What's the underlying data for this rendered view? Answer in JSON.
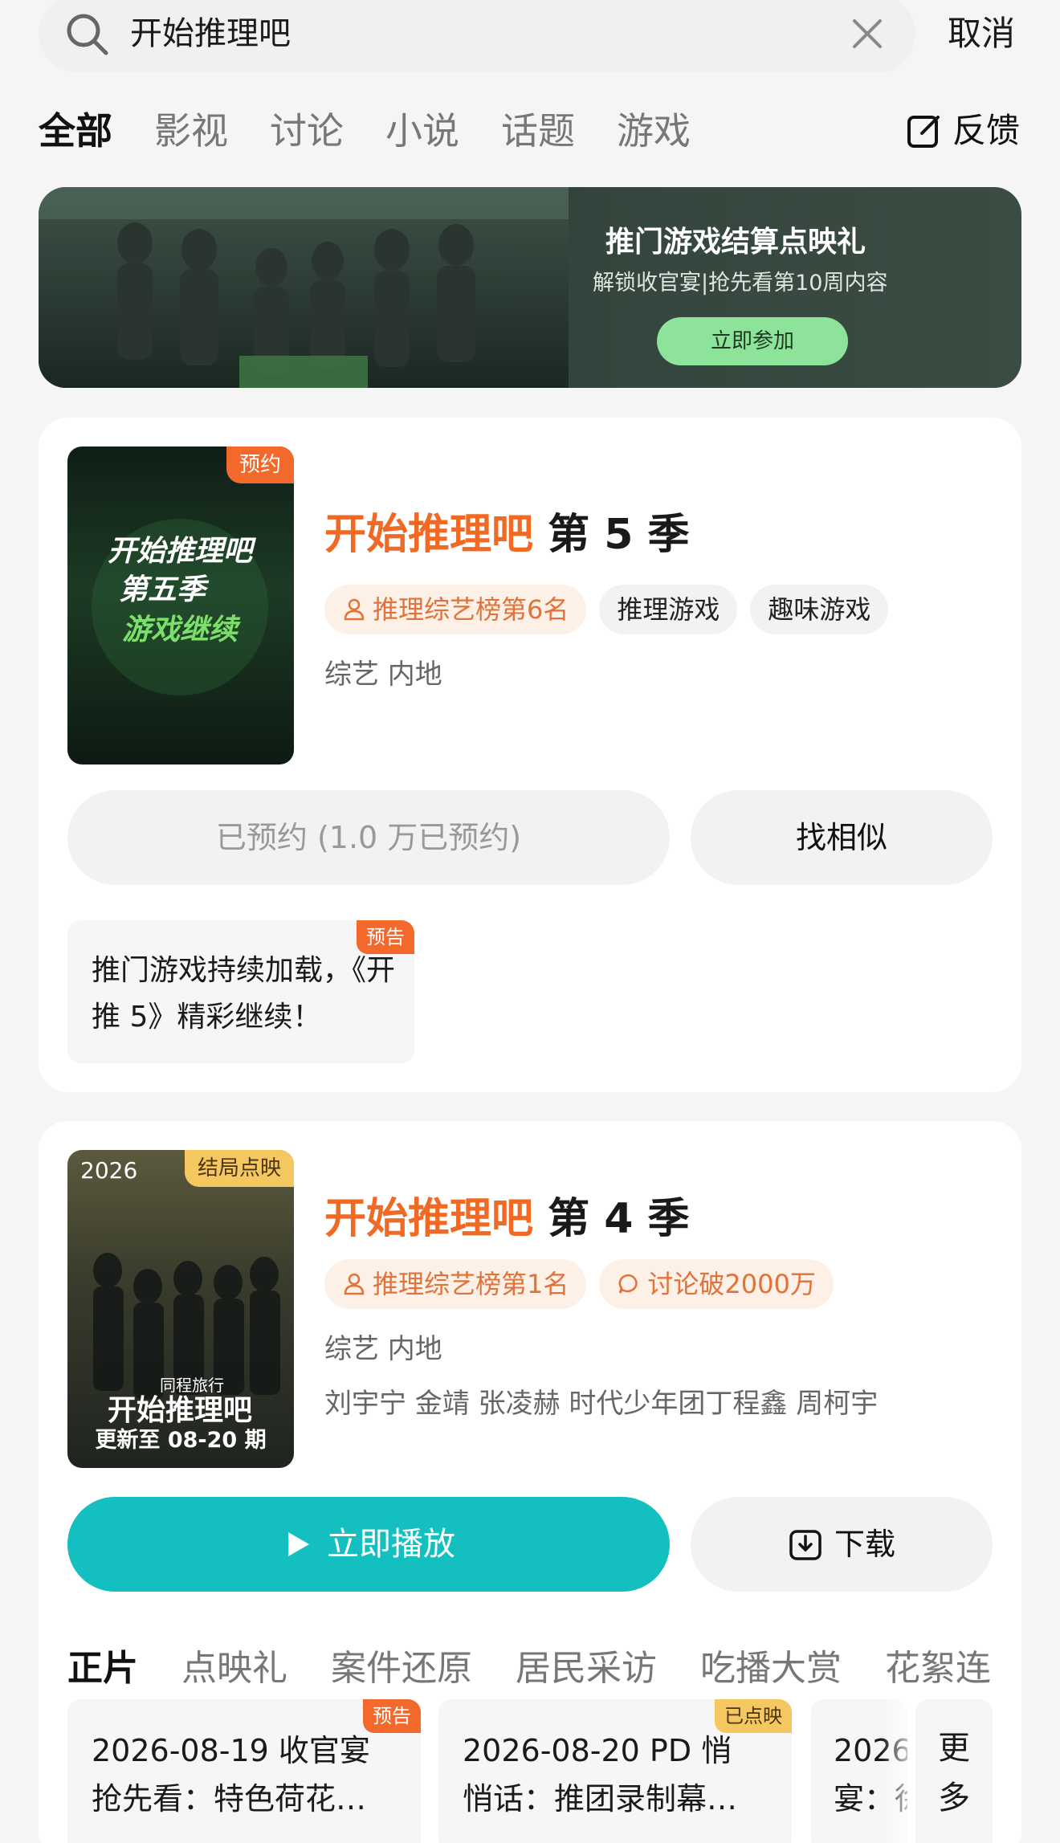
{
  "search": {
    "query": "开始推理吧",
    "cancel_label": "取消"
  },
  "tabs": [
    {
      "label": "全部",
      "active": true
    },
    {
      "label": "影视"
    },
    {
      "label": "讨论"
    },
    {
      "label": "小说"
    },
    {
      "label": "话题"
    },
    {
      "label": "游戏"
    }
  ],
  "feedback_label": "反馈",
  "banner": {
    "title": "推门游戏结算点映礼",
    "subtitle": "解锁收官宴|抢先看第10周内容",
    "button_label": "立即参加"
  },
  "results": [
    {
      "title_highlight": "开始推理吧",
      "title_rest": " 第 5 季",
      "poster_badge": "预约",
      "poster_text": [
        "开始推理吧",
        "第五季",
        "游戏继续"
      ],
      "tags": [
        "推理综艺榜第6名",
        "推理游戏",
        "趣味游戏"
      ],
      "meta": "综艺 内地",
      "primary_button": "已预约 (1.0 万已预约)",
      "secondary_button": "找相似",
      "notice_badge": "预告",
      "notice_text": "推门游戏持续加载，《开推 5》精彩继续！"
    },
    {
      "title_highlight": "开始推理吧",
      "title_rest": " 第 4 季",
      "poster_year": "2026",
      "poster_badge": "结局点映",
      "poster_brand": "同程旅行",
      "poster_logo": "开始推理吧",
      "poster_caption": "更新至 08-20 期",
      "tags": [
        "推理综艺榜第1名",
        "讨论破2000万"
      ],
      "meta": "综艺 内地",
      "cast": "刘宇宁 金靖 张凌赫 时代少年团丁程鑫 周柯宇",
      "primary_button": "立即播放",
      "secondary_button": "下载",
      "subtabs": [
        "正片",
        "点映礼",
        "案件还原",
        "居民采访",
        "吃播大赏",
        "花絮连"
      ],
      "episodes": [
        {
          "badge": "预告",
          "line1": "2026-08-19 收官宴",
          "line2": "抢先看：特色荷花…"
        },
        {
          "badge": "已点映",
          "line1": "2026-08-20 PD 悄",
          "line2": "悄话：推团录制幕…"
        },
        {
          "badge": "",
          "line1": "2026",
          "line2": "宴：徐"
        }
      ],
      "more_label": [
        "更",
        "多"
      ]
    }
  ],
  "colors": {
    "accent_orange": "#f06a25",
    "play_teal": "#14bfbf",
    "banner_button": "#8ee39a"
  }
}
